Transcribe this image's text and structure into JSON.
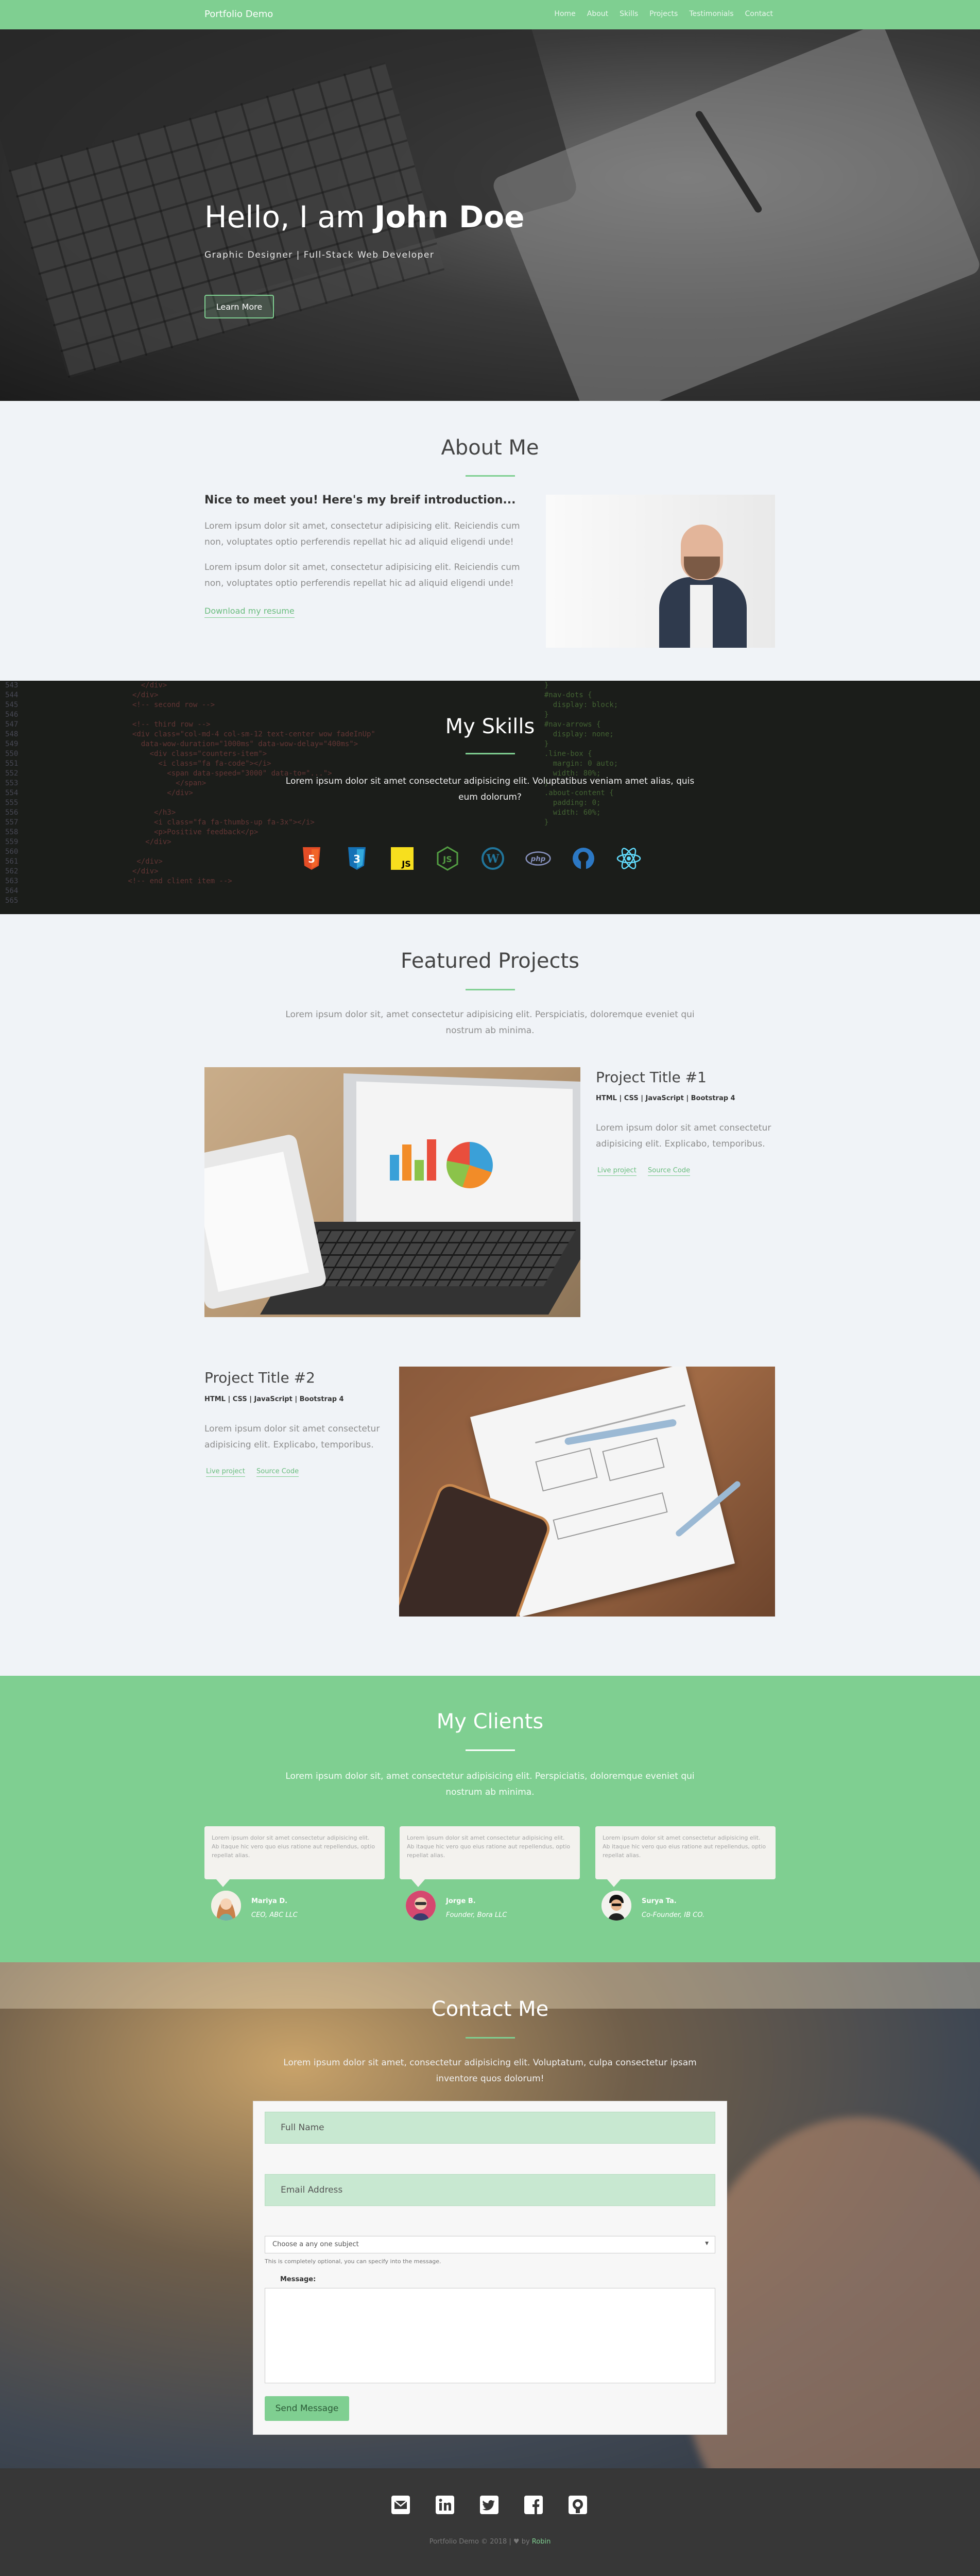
{
  "nav": {
    "brand": "Portfolio Demo",
    "links": [
      "Home",
      "About",
      "Skills",
      "Projects",
      "Testimonials",
      "Contact"
    ]
  },
  "hero": {
    "greeting": "Hello, I am ",
    "name": "John Doe",
    "subtitle": "Graphic Designer | Full-Stack Web Developer",
    "button": "Learn More"
  },
  "about": {
    "title": "About Me",
    "heading": "Nice to meet you! Here's my breif introduction...",
    "paragraphs": [
      "Lorem ipsum dolor sit amet, consectetur adipisicing elit. Reiciendis cum non, voluptates optio perferendis repellat hic ad aliquid eligendi unde!",
      "Lorem ipsum dolor sit amet, consectetur adipisicing elit. Reiciendis cum non, voluptates optio perferendis repellat hic ad aliquid eligendi unde!"
    ],
    "resume_link": "Download my resume"
  },
  "skills": {
    "title": "My Skills",
    "description": "Lorem ipsum dolor sit amet consectetur adipisicing elit. Voluptatibus veniam amet alias, quis eum dolorum?",
    "icons": [
      "html5-icon",
      "css3-icon",
      "javascript-icon",
      "nodejs-icon",
      "wordpress-icon",
      "php-icon",
      "github-icon",
      "react-icon"
    ],
    "php_label": "php",
    "js_label": "JS"
  },
  "projects": {
    "title": "Featured Projects",
    "description": "Lorem ipsum dolor sit, amet consectetur adipisicing elit. Perspiciatis, doloremque eveniet qui nostrum ab minima.",
    "items": [
      {
        "title": "Project Title #1",
        "tech": "HTML | CSS | JavaScript | Bootstrap 4",
        "text": "Lorem ipsum dolor sit amet consectetur adipisicing elit. Explicabo, temporibus.",
        "live": "Live project",
        "source": "Source Code"
      },
      {
        "title": "Project Title #2",
        "tech": "HTML | CSS | JavaScript | Bootstrap 4",
        "text": "Lorem ipsum dolor sit amet consectetur adipisicing elit. Explicabo, temporibus.",
        "live": "Live project",
        "source": "Source Code"
      }
    ]
  },
  "clients": {
    "title": "My Clients",
    "description": "Lorem ipsum dolor sit, amet consectetur adipisicing elit. Perspiciatis, doloremque eveniet qui nostrum ab minima.",
    "testimonials": [
      {
        "quote": "Lorem ipsum dolor sit amet consectetur adipisicing elit. Ab itaque hic vero quo eius ratione aut repellendus, optio repellat alias.",
        "name": "Mariya D.",
        "role": "CEO, ABC LLC"
      },
      {
        "quote": "Lorem ipsum dolor sit amet consectetur adipisicing elit. Ab itaque hic vero quo eius ratione aut repellendus, optio repellat alias.",
        "name": "Jorge B.",
        "role": "Founder, Bora LLC"
      },
      {
        "quote": "Lorem ipsum dolor sit amet consectetur adipisicing elit. Ab itaque hic vero quo eius ratione aut repellendus, optio repellat alias.",
        "name": "Surya Ta.",
        "role": "Co-Founder, IB CO."
      }
    ]
  },
  "contact": {
    "title": "Contact Me",
    "description": "Lorem ipsum dolor sit amet, consectetur adipisicing elit. Voluptatum, culpa consectetur ipsam inventore quos dolorum!",
    "full_name_placeholder": "Full Name",
    "email_placeholder": "Email Address",
    "subject_selected": "Choose a any one subject",
    "subject_hint": "This is completely optional, you can specify into the message.",
    "message_label": "Message:",
    "send_button": "Send Message"
  },
  "footer": {
    "social_icons": [
      "email-icon",
      "linkedin-icon",
      "twitter-icon",
      "facebook-icon",
      "github-icon"
    ],
    "copyright": "Portfolio Demo © 2018 | ",
    "by": " by ",
    "author": "Robin"
  },
  "colors": {
    "accent": "#7fcf91",
    "footer_bg": "#373737",
    "page_bg": "#f0f3f7"
  }
}
